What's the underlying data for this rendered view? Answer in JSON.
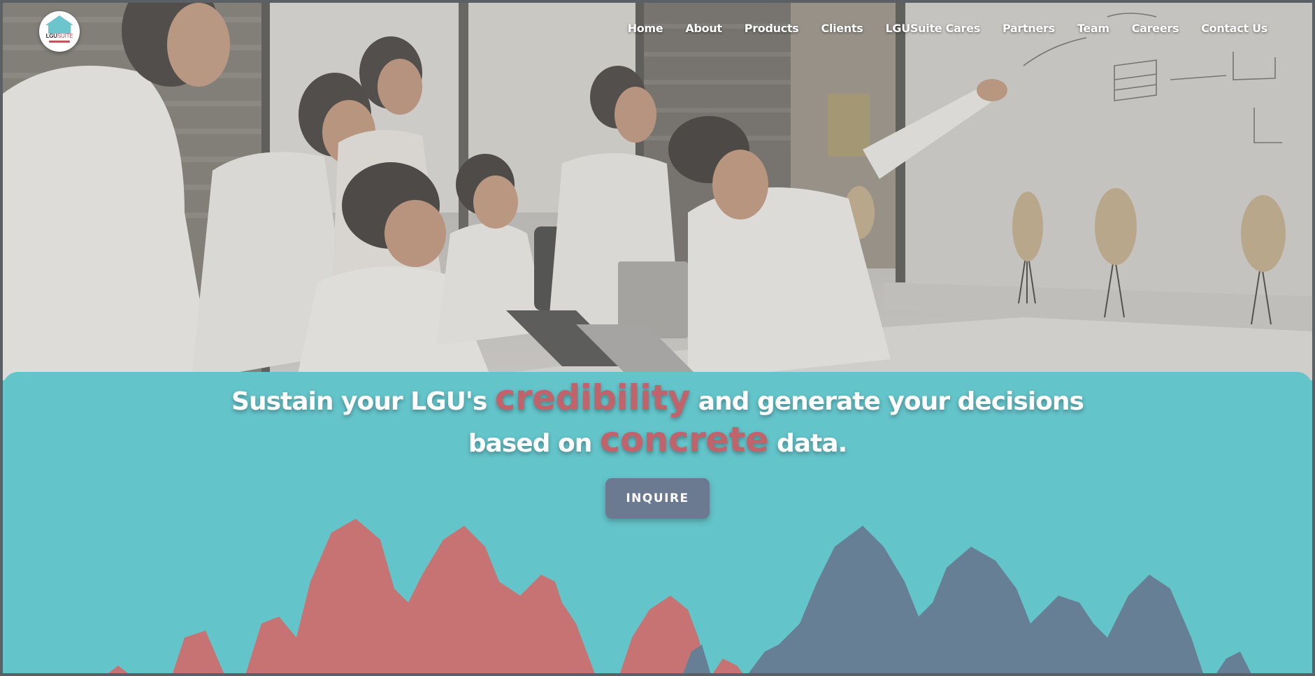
{
  "brand": {
    "logo_text_primary": "LGU",
    "logo_text_secondary": "SUITE"
  },
  "nav": {
    "items": [
      {
        "label": "Home"
      },
      {
        "label": "About"
      },
      {
        "label": "Products"
      },
      {
        "label": "Clients"
      },
      {
        "label": "LGUSuite Cares"
      },
      {
        "label": "Partners"
      },
      {
        "label": "Team"
      },
      {
        "label": "Careers"
      },
      {
        "label": "Contact Us"
      }
    ]
  },
  "hero": {
    "headline_part1": "Sustain your LGU's ",
    "headline_accent1": "credibility",
    "headline_part2": " and generate your decisions",
    "headline_part3": "based on ",
    "headline_accent2": "concrete",
    "headline_part4": " data.",
    "cta_label": "INQUIRE"
  },
  "colors": {
    "panel_bg": "#63c4c9",
    "accent": "#c0636b",
    "button_bg": "#6b7a90",
    "mountain_red": "#c77373",
    "mountain_slate": "#667f95"
  }
}
